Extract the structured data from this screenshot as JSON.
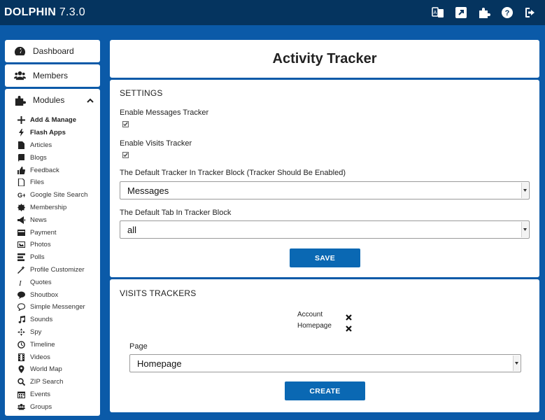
{
  "app": {
    "brand": "DOLPHIN",
    "version": "7.3.0"
  },
  "topbar": {
    "icons": [
      "language-icon",
      "external-link-icon",
      "puzzle-icon",
      "help-icon",
      "logout-icon"
    ]
  },
  "sidebar": {
    "dashboard_label": "Dashboard",
    "members_label": "Members",
    "modules_label": "Modules",
    "modules": [
      {
        "label": "Add & Manage",
        "icon": "plus-icon",
        "bold": true
      },
      {
        "label": "Flash Apps",
        "icon": "bolt-icon",
        "bold": true
      },
      {
        "label": "Articles",
        "icon": "document-icon",
        "bold": false
      },
      {
        "label": "Blogs",
        "icon": "book-icon",
        "bold": false
      },
      {
        "label": "Feedback",
        "icon": "thumbs-up-icon",
        "bold": false
      },
      {
        "label": "Files",
        "icon": "file-icon",
        "bold": false
      },
      {
        "label": "Google Site Search",
        "icon": "google-plus-icon",
        "bold": false
      },
      {
        "label": "Membership",
        "icon": "badge-icon",
        "bold": false
      },
      {
        "label": "News",
        "icon": "megaphone-icon",
        "bold": false
      },
      {
        "label": "Payment",
        "icon": "credit-card-icon",
        "bold": false
      },
      {
        "label": "Photos",
        "icon": "image-icon",
        "bold": false
      },
      {
        "label": "Polls",
        "icon": "tasks-icon",
        "bold": false
      },
      {
        "label": "Profile Customizer",
        "icon": "magic-wand-icon",
        "bold": false
      },
      {
        "label": "Quotes",
        "icon": "italic-icon",
        "bold": false
      },
      {
        "label": "Shoutbox",
        "icon": "speech-bubble-icon",
        "bold": false
      },
      {
        "label": "Simple Messenger",
        "icon": "chat-icon",
        "bold": false
      },
      {
        "label": "Sounds",
        "icon": "music-icon",
        "bold": false
      },
      {
        "label": "Spy",
        "icon": "crosshair-icon",
        "bold": false
      },
      {
        "label": "Timeline",
        "icon": "clock-icon",
        "bold": false
      },
      {
        "label": "Videos",
        "icon": "film-icon",
        "bold": false
      },
      {
        "label": "World Map",
        "icon": "map-marker-icon",
        "bold": false
      },
      {
        "label": "ZIP Search",
        "icon": "search-icon",
        "bold": false
      },
      {
        "label": "Events",
        "icon": "calendar-icon",
        "bold": false
      },
      {
        "label": "Groups",
        "icon": "users-icon",
        "bold": false
      }
    ]
  },
  "page": {
    "title": "Activity Tracker"
  },
  "settings": {
    "section_title": "SETTINGS",
    "messages_tracker_label": "Enable Messages Tracker",
    "messages_tracker_checked": true,
    "visits_tracker_label": "Enable Visits Tracker",
    "visits_tracker_checked": true,
    "default_tracker_label": "The Default Tracker In Tracker Block (Tracker Should Be Enabled)",
    "default_tracker_value": "Messages",
    "default_tab_label": "The Default Tab In Tracker Block",
    "default_tab_value": "all",
    "save_label": "SAVE"
  },
  "visits": {
    "section_title": "VISITS TRACKERS",
    "trackers": [
      {
        "label": "Account"
      },
      {
        "label": "Homepage"
      }
    ],
    "page_label": "Page",
    "page_value": "Homepage",
    "create_label": "CREATE"
  },
  "colors": {
    "topbar": "#05345f",
    "background": "#0b5aa8",
    "button": "#0a68b3"
  }
}
